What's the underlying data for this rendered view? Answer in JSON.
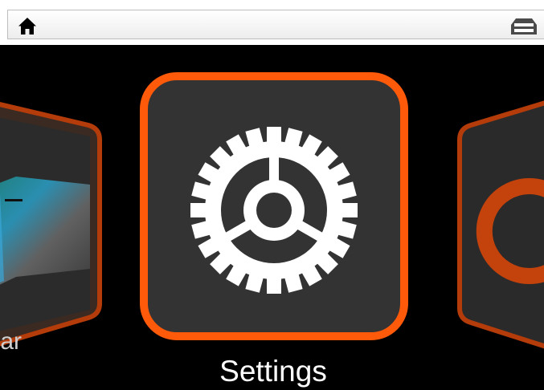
{
  "top_bar": {
    "left_icon": "home-icon",
    "right_icon": "connection-icon"
  },
  "carousel": {
    "current": {
      "label": "Settings",
      "icon": "gear-icon",
      "accent_color": "#ff5a0a"
    },
    "previous": {
      "label_visible": "ar",
      "icon": "chart-image-icon"
    },
    "next": {
      "icon": "power-icon"
    }
  },
  "colors": {
    "accent": "#ff5a0a",
    "tile_background": "#333333",
    "screen_background": "#000000"
  }
}
